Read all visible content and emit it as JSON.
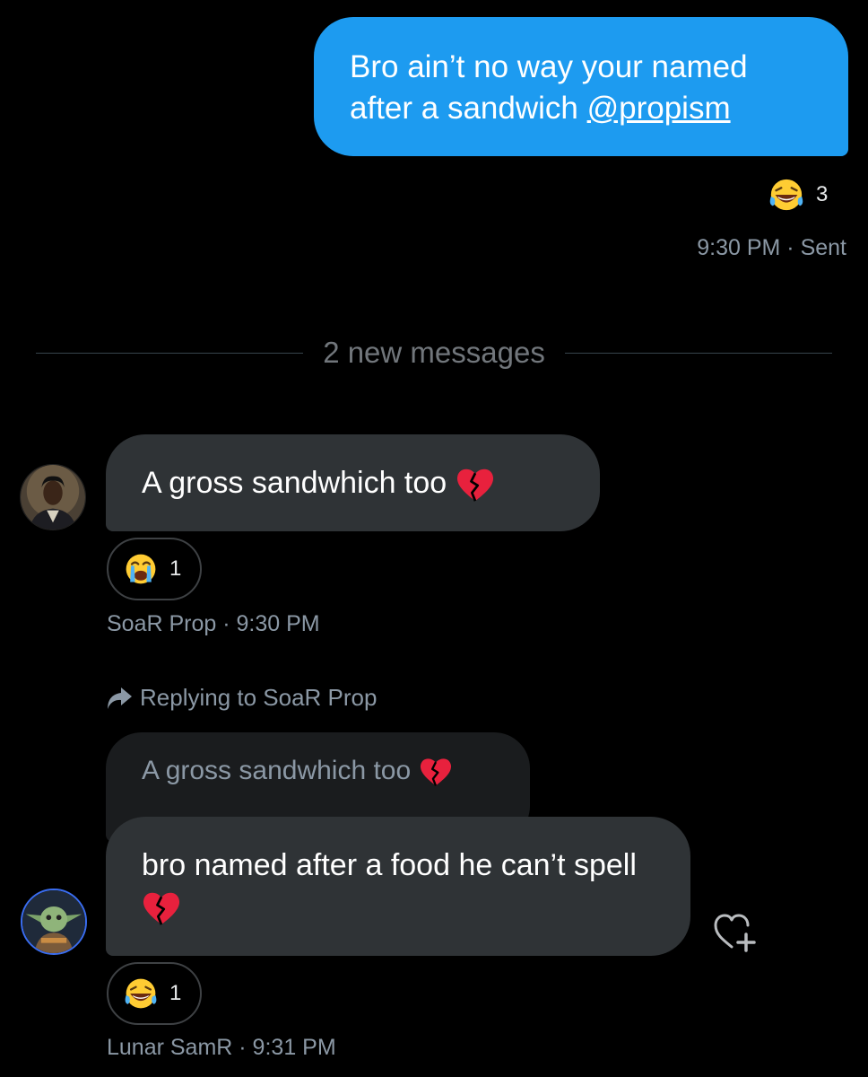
{
  "sent_message": {
    "text": "Bro ain’t no way your named after a sandwich ",
    "mention": "@propism",
    "reaction": {
      "emoji": "laughing-tears",
      "count": "3"
    },
    "meta": "9:30 PM · Sent"
  },
  "divider": {
    "label": "2 new messages"
  },
  "messages": [
    {
      "author": "SoaR Prop",
      "text": "A gross sandwhich too ",
      "emoji": "broken-heart",
      "reaction": {
        "emoji": "crying-face",
        "count": "1"
      },
      "meta": "SoaR Prop · 9:30 PM"
    },
    {
      "author": "Lunar SamR",
      "replying_to": "Replying to SoaR Prop",
      "quoted_text": "A gross sandwhich too ",
      "text": "bro named after a food he can’t spell ",
      "emoji": "broken-heart",
      "reaction": {
        "emoji": "laughing-tears",
        "count": "1"
      },
      "meta": "Lunar SamR · 9:31 PM"
    }
  ],
  "colors": {
    "background": "#000000",
    "sent_bubble": "#1d9bf0",
    "received_bubble": "#2f3336",
    "meta_text": "#8b98a5"
  }
}
